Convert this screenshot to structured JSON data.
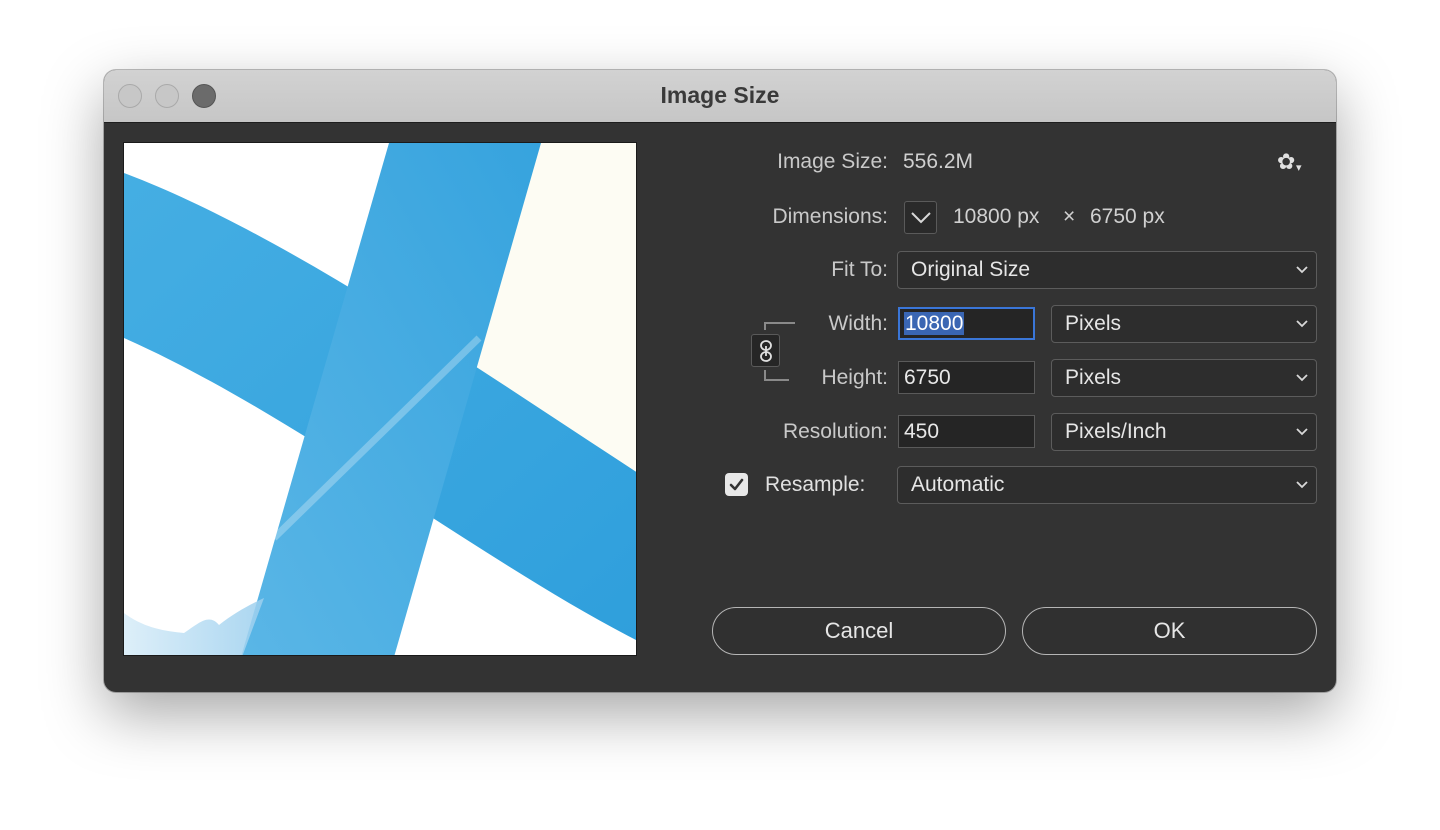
{
  "window": {
    "title": "Image Size"
  },
  "image_size": {
    "label": "Image Size:",
    "value": "556.2M"
  },
  "dimensions": {
    "label": "Dimensions:",
    "width": "10800 px",
    "times": "×",
    "height": "6750 px"
  },
  "fit_to": {
    "label": "Fit To:",
    "selected": "Original Size"
  },
  "width": {
    "label": "Width:",
    "value": "10800",
    "unit": "Pixels"
  },
  "height": {
    "label": "Height:",
    "value": "6750",
    "unit": "Pixels"
  },
  "resolution": {
    "label": "Resolution:",
    "value": "450",
    "unit": "Pixels/Inch"
  },
  "resample": {
    "label": "Resample:",
    "checked": true,
    "selected": "Automatic"
  },
  "buttons": {
    "cancel": "Cancel",
    "ok": "OK"
  },
  "icons": {
    "settings": "gear-icon",
    "dimensions_toggle": "chevron-down-icon",
    "constrain": "link-icon",
    "checkbox": "checkmark-icon",
    "dropdown": "chevron-down-icon"
  },
  "colors": {
    "dialog_bg": "#333333",
    "titlebar_bg": "#c8c8c8",
    "focus_ring": "#3a76d8",
    "preview_blue": "#3aa6df"
  }
}
